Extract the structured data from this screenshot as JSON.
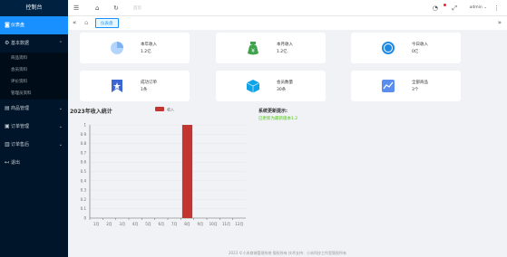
{
  "app": {
    "title": "控制台"
  },
  "sidebar": {
    "items": [
      {
        "label": "仪表盘",
        "icon": "dashboard-icon",
        "glyph": "◙",
        "active": true,
        "has_arrow": false
      },
      {
        "label": "基本数据",
        "icon": "gear-icon",
        "glyph": "⚙",
        "active": false,
        "has_arrow": true,
        "arrow": "⌃"
      },
      {
        "label": "商品管理",
        "icon": "shop-icon",
        "glyph": "▤",
        "active": false,
        "has_arrow": true,
        "arrow": "⌄"
      },
      {
        "label": "订单管理",
        "icon": "order-icon",
        "glyph": "▣",
        "active": false,
        "has_arrow": true,
        "arrow": "⌄"
      },
      {
        "label": "订单售后",
        "icon": "after-sale-icon",
        "glyph": "▥",
        "active": false,
        "has_arrow": true,
        "arrow": "⌄"
      },
      {
        "label": "退出",
        "icon": "logout-icon",
        "glyph": "↤",
        "active": false,
        "has_arrow": false
      }
    ],
    "submenu": [
      "商品资料",
      "会员资料",
      "评价资料",
      "管理员资料"
    ]
  },
  "header": {
    "crumb": "首页",
    "user": "admin",
    "user_arrow": "⌄",
    "icons": {
      "menu": "☰",
      "home": "⌂",
      "refresh": "↻",
      "bell": "◔",
      "expand": "⤢",
      "more": "⋮",
      "left": "«",
      "right": "»"
    }
  },
  "tabs": {
    "active": "仪表盘"
  },
  "cards": [
    {
      "label": "本年收入",
      "value": "1.2亿",
      "icon": "pie-chart-icon",
      "color": "#b3d4fc"
    },
    {
      "label": "本月收入",
      "value": "1.2亿",
      "icon": "money-bag-icon",
      "color": "#3fa34d"
    },
    {
      "label": "今日收入",
      "value": "0亿",
      "icon": "coin-icon",
      "color": "#1e88e5"
    },
    {
      "label": "成功订单",
      "value": "1条",
      "icon": "bookmark-icon",
      "color": "#3c66d4"
    },
    {
      "label": "会员数量",
      "value": "30条",
      "icon": "cube-icon",
      "color": "#0fa3e8"
    },
    {
      "label": "全部商品",
      "value": "3个",
      "icon": "trend-icon",
      "color": "#5b8def"
    }
  ],
  "chart_data": {
    "type": "bar",
    "title": "2023年收入统计",
    "categories": [
      "1月",
      "2月",
      "3月",
      "4月",
      "5月",
      "6月",
      "7月",
      "8月",
      "9月",
      "10月",
      "11月",
      "12月"
    ],
    "series": [
      {
        "name": "收入",
        "values": [
          0,
          0,
          0,
          0,
          0,
          0,
          0,
          1,
          0,
          0,
          0,
          0
        ],
        "color": "#c23531"
      }
    ],
    "y_ticks": [
      "1",
      "0.9",
      "0.8",
      "0.7",
      "0.6",
      "0.5",
      "0.4",
      "0.3",
      "0.2",
      "0.1",
      "0"
    ],
    "ylim": [
      0,
      1
    ],
    "grid": true,
    "legend_position": "top-center"
  },
  "system": {
    "title": "系统更新提示:",
    "text": "已更新为最新版本1.2"
  },
  "footer": {
    "text": "2023 ©小米商城管理系统 版权所有 技术支持：小米科技工作室版权所有"
  }
}
